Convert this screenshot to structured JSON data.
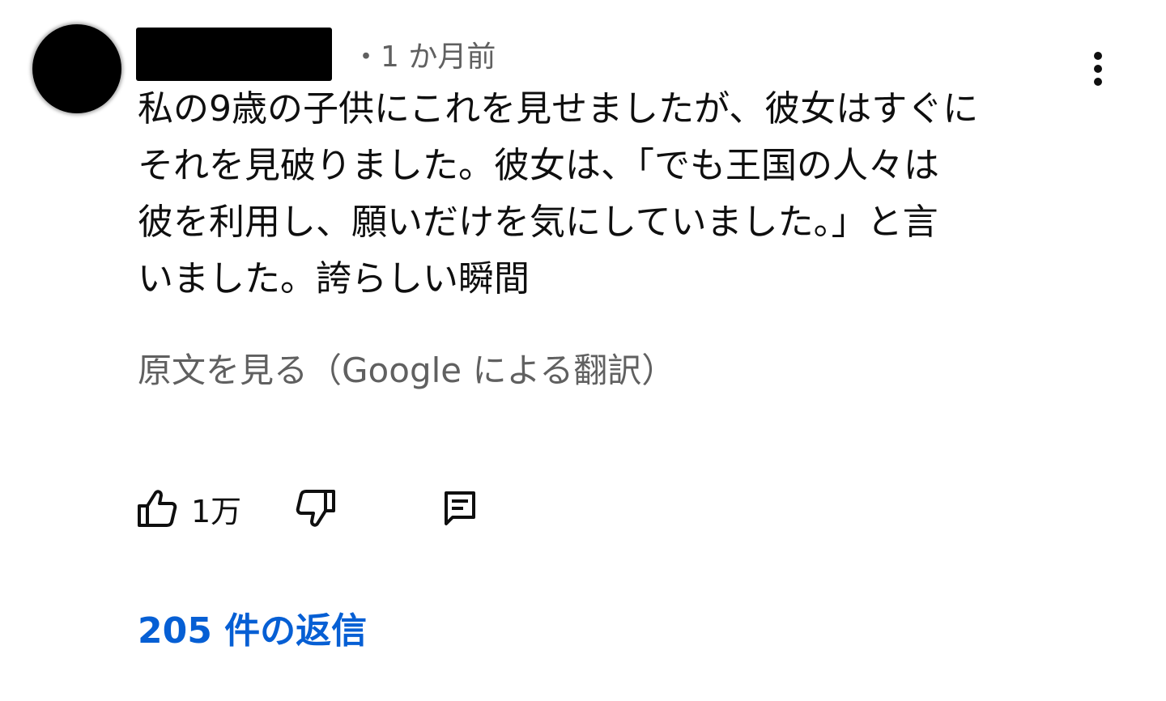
{
  "comment": {
    "author": "",
    "timestamp": "・1 か月前",
    "text_lines": [
      "私の9歳の子供にこれを見せましたが、彼女はすぐに",
      "それを見破りました。彼女は、「でも王国の人々は",
      "彼を利用し、願いだけを気にしていました。」と言",
      "いました。誇らしい瞬間"
    ],
    "see_original_label": "原文を見る（Google による翻訳）",
    "like_count": "1万",
    "replies_label": "205 件の返信"
  },
  "icons": {
    "more": "more-vert-icon",
    "like": "thumb-up-icon",
    "dislike": "thumb-down-icon",
    "reply": "comment-icon"
  },
  "colors": {
    "text": "#0f0f0f",
    "secondary": "#606060",
    "link": "#065fd4",
    "background": "#ffffff"
  }
}
